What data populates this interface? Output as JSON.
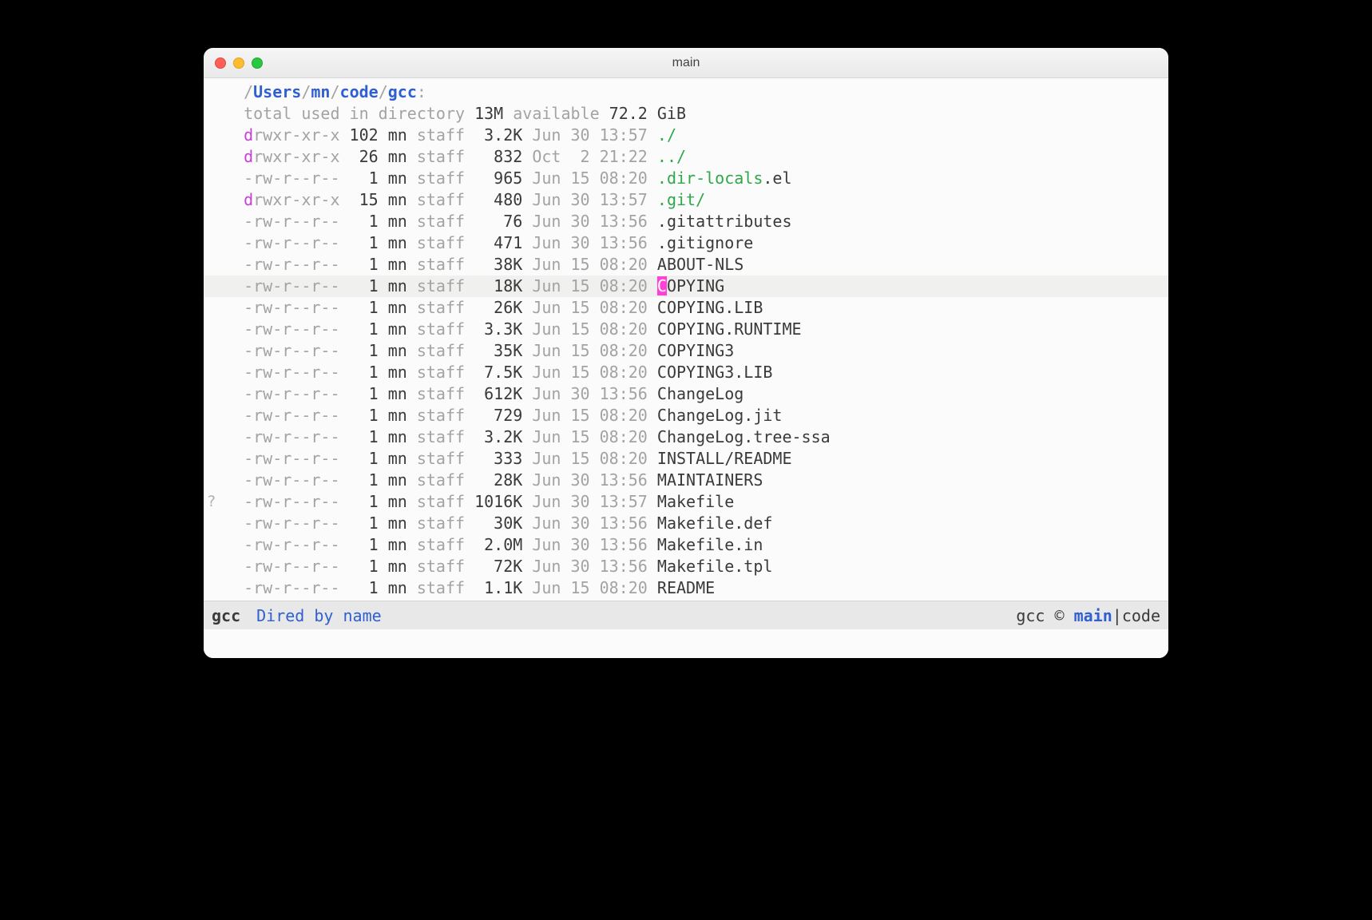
{
  "window": {
    "title": "main"
  },
  "path_segments": [
    "Users",
    "mn",
    "code",
    "gcc"
  ],
  "summary": {
    "prefix": "total used in directory ",
    "used": "13M",
    "mid": " available ",
    "avail": "72.2 GiB"
  },
  "entries": [
    {
      "perm_d": "d",
      "perm_rest": "rwxr-xr-x",
      "links": "102",
      "user": "mn",
      "group": "staff",
      "size": "3.2K",
      "date": "Jun 30 13:57",
      "name_a": "./",
      "style": "dir"
    },
    {
      "perm_d": "d",
      "perm_rest": "rwxr-xr-x",
      "links": "26",
      "user": "mn",
      "group": "staff",
      "size": "832",
      "date": "Oct  2 21:22",
      "name_a": "../",
      "style": "dir"
    },
    {
      "perm_d": "-",
      "perm_rest": "rw-r--r--",
      "links": "1",
      "user": "mn",
      "group": "staff",
      "size": "965",
      "date": "Jun 15 08:20",
      "name_a": ".dir-locals",
      "name_b": ".el",
      "style": "split"
    },
    {
      "perm_d": "d",
      "perm_rest": "rwxr-xr-x",
      "links": "15",
      "user": "mn",
      "group": "staff",
      "size": "480",
      "date": "Jun 30 13:57",
      "name_a": ".git",
      "name_b": "/",
      "style": "gitdir"
    },
    {
      "perm_d": "-",
      "perm_rest": "rw-r--r--",
      "links": "1",
      "user": "mn",
      "group": "staff",
      "size": "76",
      "date": "Jun 30 13:56",
      "name_a": ".gitattributes",
      "style": "plain"
    },
    {
      "perm_d": "-",
      "perm_rest": "rw-r--r--",
      "links": "1",
      "user": "mn",
      "group": "staff",
      "size": "471",
      "date": "Jun 30 13:56",
      "name_a": ".gitignore",
      "style": "plain"
    },
    {
      "perm_d": "-",
      "perm_rest": "rw-r--r--",
      "links": "1",
      "user": "mn",
      "group": "staff",
      "size": "38K",
      "date": "Jun 15 08:20",
      "name_a": "ABOUT-NLS",
      "style": "plain"
    },
    {
      "perm_d": "-",
      "perm_rest": "rw-r--r--",
      "links": "1",
      "user": "mn",
      "group": "staff",
      "size": "18K",
      "date": "Jun 15 08:20",
      "name_a": "C",
      "name_b": "OPYING",
      "style": "cursor"
    },
    {
      "perm_d": "-",
      "perm_rest": "rw-r--r--",
      "links": "1",
      "user": "mn",
      "group": "staff",
      "size": "26K",
      "date": "Jun 15 08:20",
      "name_a": "COPYING.LIB",
      "style": "plain"
    },
    {
      "perm_d": "-",
      "perm_rest": "rw-r--r--",
      "links": "1",
      "user": "mn",
      "group": "staff",
      "size": "3.3K",
      "date": "Jun 15 08:20",
      "name_a": "COPYING.RUNTIME",
      "style": "plain"
    },
    {
      "perm_d": "-",
      "perm_rest": "rw-r--r--",
      "links": "1",
      "user": "mn",
      "group": "staff",
      "size": "35K",
      "date": "Jun 15 08:20",
      "name_a": "COPYING3",
      "style": "plain"
    },
    {
      "perm_d": "-",
      "perm_rest": "rw-r--r--",
      "links": "1",
      "user": "mn",
      "group": "staff",
      "size": "7.5K",
      "date": "Jun 15 08:20",
      "name_a": "COPYING3.LIB",
      "style": "plain"
    },
    {
      "perm_d": "-",
      "perm_rest": "rw-r--r--",
      "links": "1",
      "user": "mn",
      "group": "staff",
      "size": "612K",
      "date": "Jun 30 13:56",
      "name_a": "ChangeLog",
      "style": "plain"
    },
    {
      "perm_d": "-",
      "perm_rest": "rw-r--r--",
      "links": "1",
      "user": "mn",
      "group": "staff",
      "size": "729",
      "date": "Jun 15 08:20",
      "name_a": "ChangeLog.jit",
      "style": "plain"
    },
    {
      "perm_d": "-",
      "perm_rest": "rw-r--r--",
      "links": "1",
      "user": "mn",
      "group": "staff",
      "size": "3.2K",
      "date": "Jun 15 08:20",
      "name_a": "ChangeLog.tree-ssa",
      "style": "plain"
    },
    {
      "perm_d": "-",
      "perm_rest": "rw-r--r--",
      "links": "1",
      "user": "mn",
      "group": "staff",
      "size": "333",
      "date": "Jun 15 08:20",
      "name_a": "INSTALL/README",
      "style": "plain"
    },
    {
      "perm_d": "-",
      "perm_rest": "rw-r--r--",
      "links": "1",
      "user": "mn",
      "group": "staff",
      "size": "28K",
      "date": "Jun 30 13:56",
      "name_a": "MAINTAINERS",
      "style": "plain"
    },
    {
      "perm_d": "-",
      "perm_rest": "rw-r--r--",
      "links": "1",
      "user": "mn",
      "group": "staff",
      "size": "1016K",
      "date": "Jun 30 13:57",
      "name_a": "Makefile",
      "style": "plain",
      "gutter": "?"
    },
    {
      "perm_d": "-",
      "perm_rest": "rw-r--r--",
      "links": "1",
      "user": "mn",
      "group": "staff",
      "size": "30K",
      "date": "Jun 30 13:56",
      "name_a": "Makefile.def",
      "style": "plain"
    },
    {
      "perm_d": "-",
      "perm_rest": "rw-r--r--",
      "links": "1",
      "user": "mn",
      "group": "staff",
      "size": "2.0M",
      "date": "Jun 30 13:56",
      "name_a": "Makefile.in",
      "style": "plain"
    },
    {
      "perm_d": "-",
      "perm_rest": "rw-r--r--",
      "links": "1",
      "user": "mn",
      "group": "staff",
      "size": "72K",
      "date": "Jun 30 13:56",
      "name_a": "Makefile.tpl",
      "style": "plain"
    },
    {
      "perm_d": "-",
      "perm_rest": "rw-r--r--",
      "links": "1",
      "user": "mn",
      "group": "staff",
      "size": "1.1K",
      "date": "Jun 15 08:20",
      "name_a": "README",
      "style": "plain"
    }
  ],
  "modeline": {
    "buffer": "gcc",
    "mode": "Dired by name",
    "vc_dir": "gcc",
    "vc_sym": "©",
    "vc_branch": "main",
    "vc_sep": "|",
    "vc_proj": "code"
  }
}
